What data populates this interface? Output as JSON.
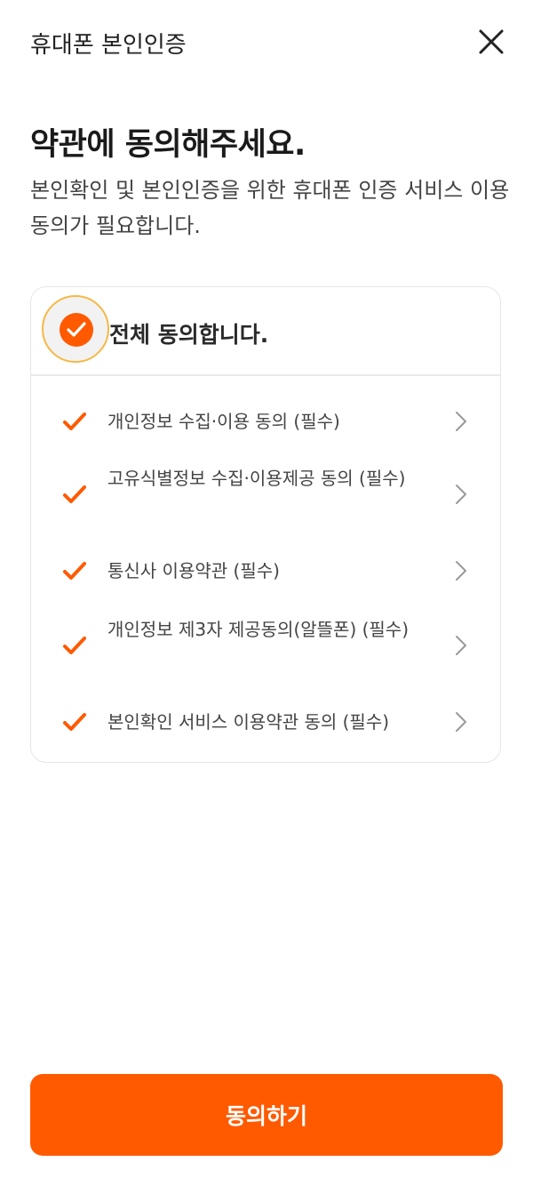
{
  "header": {
    "title": "휴대폰 본인인증",
    "close_icon": "close-icon"
  },
  "main": {
    "heading": "약관에 동의해주세요.",
    "description": "본인확인 및 본인인증을 위한 휴대폰 인증 서비스 이용 동의가 필요합니다."
  },
  "agreements": {
    "all_label": "전체 동의합니다.",
    "all_checked": true,
    "items": [
      {
        "label": "개인정보 수집·이용 동의 (필수)",
        "checked": true
      },
      {
        "label": "고유식별정보 수집·이용제공 동의 (필수)",
        "checked": true
      },
      {
        "label": "통신사 이용약관 (필수)",
        "checked": true
      },
      {
        "label": "개인정보 제3자 제공동의(알뜰폰) (필수)",
        "checked": true
      },
      {
        "label": "본인확인 서비스 이용약관 동의 (필수)",
        "checked": true
      }
    ]
  },
  "cta": {
    "label": "동의하기"
  },
  "colors": {
    "accent": "#ff5a00",
    "focus_ring": "#f5b945"
  }
}
